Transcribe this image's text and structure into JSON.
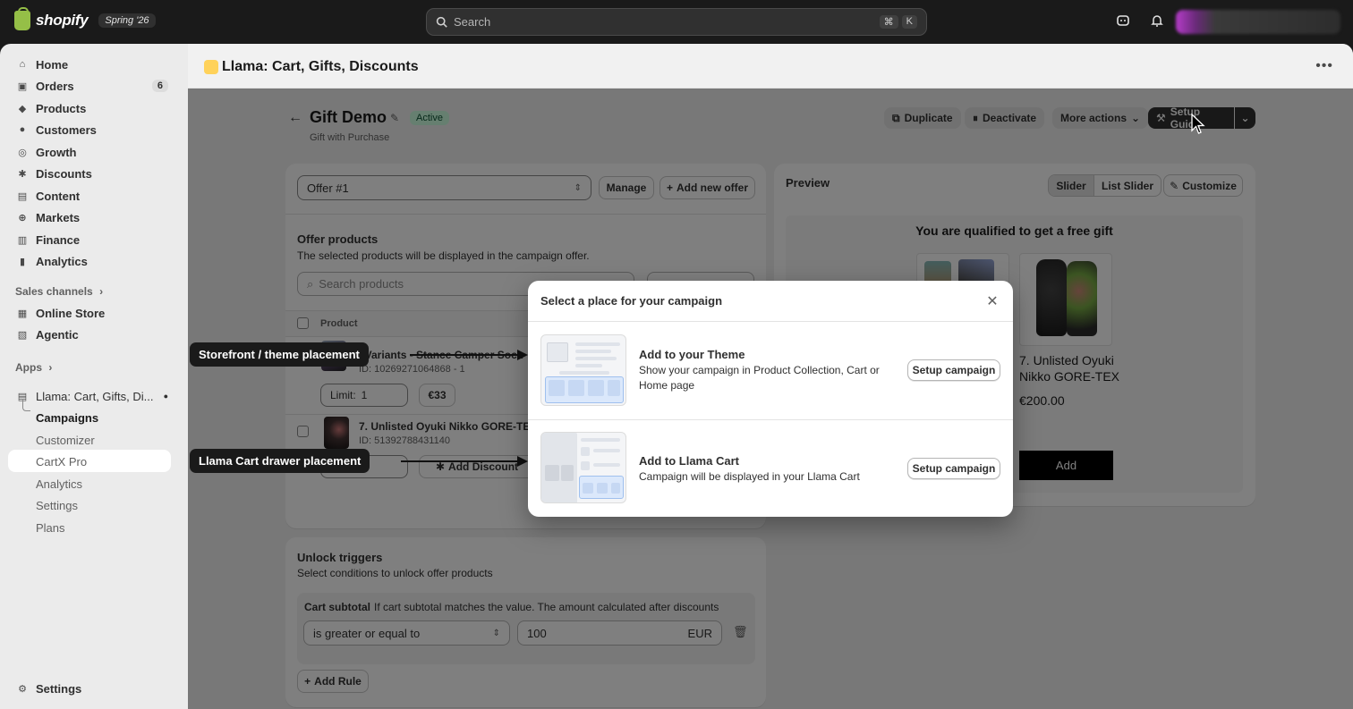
{
  "topbar": {
    "logo_text": "shopify",
    "edition": "Spring '26",
    "search_placeholder": "Search",
    "shortcut_keys": [
      "⌘",
      "K"
    ]
  },
  "sidebar": {
    "items": [
      {
        "label": "Home",
        "icon": "home-icon"
      },
      {
        "label": "Orders",
        "icon": "orders-icon",
        "count": "6"
      },
      {
        "label": "Products",
        "icon": "tag-icon"
      },
      {
        "label": "Customers",
        "icon": "person-icon"
      },
      {
        "label": "Growth",
        "icon": "growth-icon"
      },
      {
        "label": "Discounts",
        "icon": "discount-icon"
      },
      {
        "label": "Content",
        "icon": "content-icon"
      },
      {
        "label": "Markets",
        "icon": "globe-icon"
      },
      {
        "label": "Finance",
        "icon": "bank-icon"
      },
      {
        "label": "Analytics",
        "icon": "chart-icon"
      }
    ],
    "sales_channels_label": "Sales channels",
    "channels": [
      {
        "label": "Online Store",
        "icon": "store-icon"
      },
      {
        "label": "Agentic",
        "icon": "agentic-icon"
      }
    ],
    "apps_label": "Apps",
    "app_name": "Llama: Cart, Gifts, Di...",
    "app_subitems": [
      "Campaigns",
      "Customizer",
      "CartX Pro",
      "Analytics",
      "Settings",
      "Plans"
    ],
    "settings_label": "Settings"
  },
  "app_header": {
    "title": "Llama: Cart, Gifts, Discounts"
  },
  "page": {
    "title": "Gift Demo",
    "status": "Active",
    "subtitle": "Gift with Purchase",
    "actions": {
      "duplicate": "Duplicate",
      "deactivate": "Deactivate",
      "more_actions": "More actions",
      "setup_guide": "Setup Guide"
    }
  },
  "offer_card": {
    "offer_select": "Offer #1",
    "manage": "Manage",
    "add_new_offer": "Add new offer",
    "products_title": "Offer products",
    "products_desc": "The selected products will be displayed in the campaign offer.",
    "search_placeholder": "Search products",
    "col_product": "Product",
    "rows": [
      {
        "name": ". Variants - Stance Camper Sock",
        "id": "ID: 10269271064868 - 1",
        "limit_label": "Limit:",
        "limit_value": "1",
        "price": "€33"
      },
      {
        "name": "7. Unlisted Oyuki Nikko GORE-TEX",
        "id": "ID: 51392788431140",
        "add_discount": "Add Discount"
      }
    ]
  },
  "triggers_card": {
    "title": "Unlock triggers",
    "desc": "Select conditions to unlock offer products",
    "rule_label": "Cart subtotal",
    "rule_desc": "If cart subtotal matches the value. The amount calculated after discounts",
    "operator": "is greater or equal to",
    "value": "100",
    "currency": "EUR",
    "add_rule": "Add Rule"
  },
  "preview_card": {
    "title": "Preview",
    "tabs": [
      "Slider",
      "List Slider"
    ],
    "customize": "Customize",
    "heading": "You are qualified to get a free gift",
    "product_name": "7. Unlisted Oyuki Nikko GORE-TEX",
    "product_price": "€200.00",
    "add_button": "Add"
  },
  "callouts": {
    "storefront": "Storefront / theme placement",
    "cart_drawer": "Llama Cart drawer placement"
  },
  "modal": {
    "title": "Select a place for your campaign",
    "options": [
      {
        "title": "Add to your Theme",
        "desc": "Show your campaign in Product Collection, Cart or Home page",
        "button": "Setup campaign"
      },
      {
        "title": "Add to Llama Cart",
        "desc": "Campaign will be displayed in your Llama Cart",
        "button": "Setup campaign"
      }
    ]
  }
}
